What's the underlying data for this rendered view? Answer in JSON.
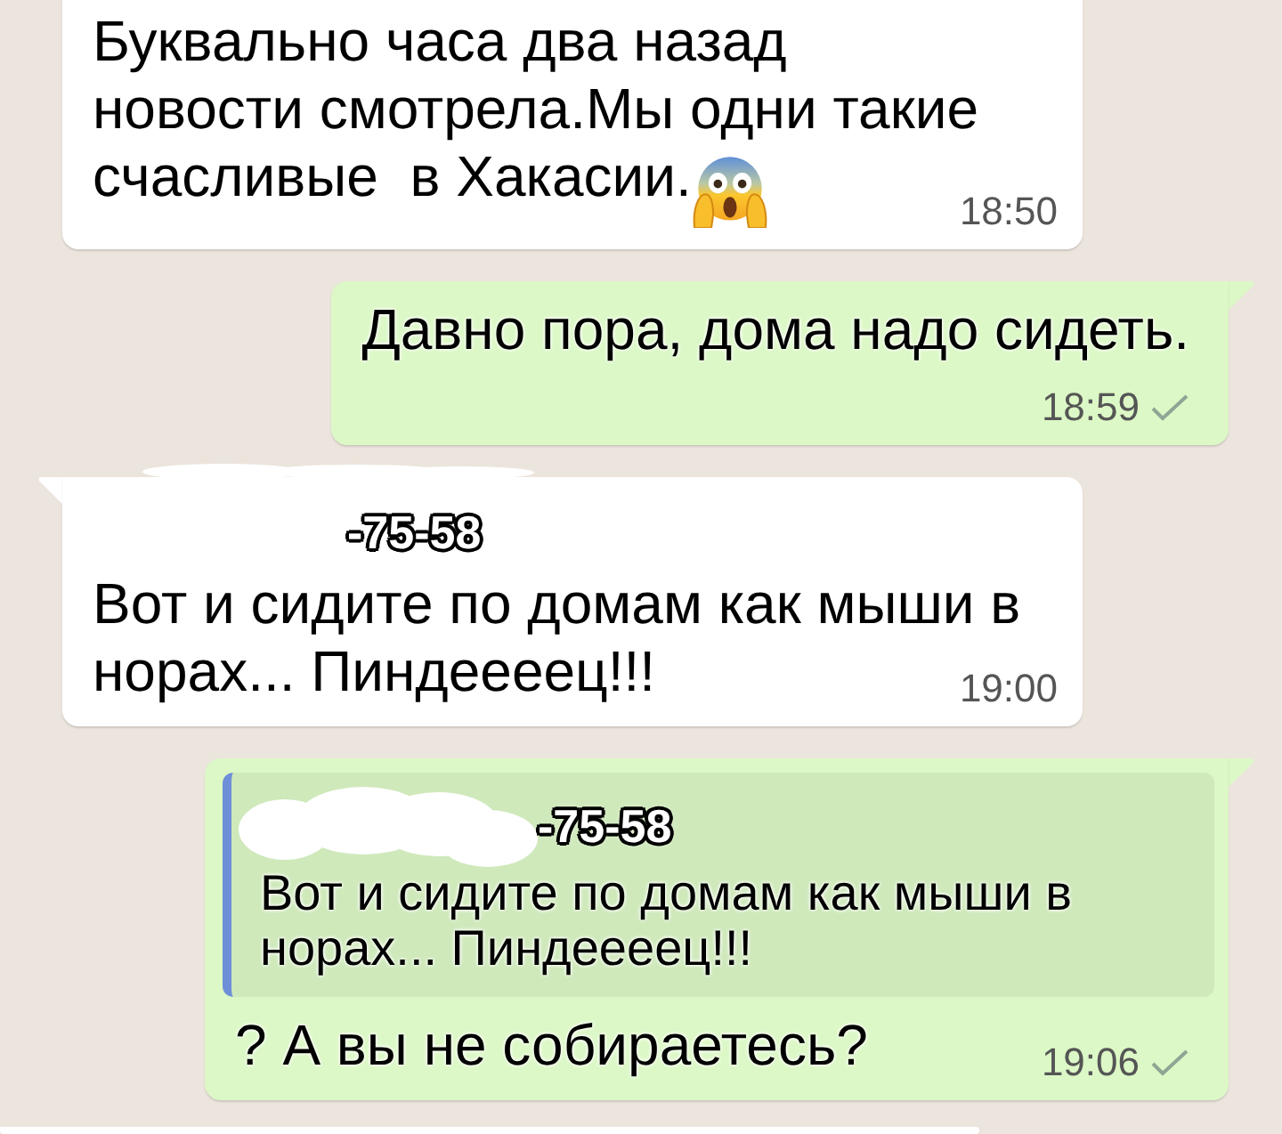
{
  "messages": [
    {
      "kind": "incoming",
      "lines": [
        "Буквально часа два назад",
        "новости смотрела.Мы одни такие",
        "счасливые  в Хакасии."
      ],
      "trailing_emoji": true,
      "time": "18:50"
    },
    {
      "kind": "outgoing",
      "lines": [
        "Давно пора, дома надо сидеть."
      ],
      "time": "18:59",
      "sent": true
    },
    {
      "kind": "incoming",
      "sender": "-75-58",
      "sender_covered": true,
      "lines": [
        "Вот и сидите по домам как мыши в",
        "норах... Пиндеееец!!!"
      ],
      "time": "19:00"
    },
    {
      "kind": "outgoing",
      "quote": {
        "sender": "-75-58",
        "sender_covered": true,
        "text": "Вот и сидите по домам как мыши в\nнорах... Пиндеееец!!!"
      },
      "lines": [
        "? А вы не собираетесь?"
      ],
      "time": "19:06",
      "sent": true
    },
    {
      "kind": "incoming"
    }
  ]
}
